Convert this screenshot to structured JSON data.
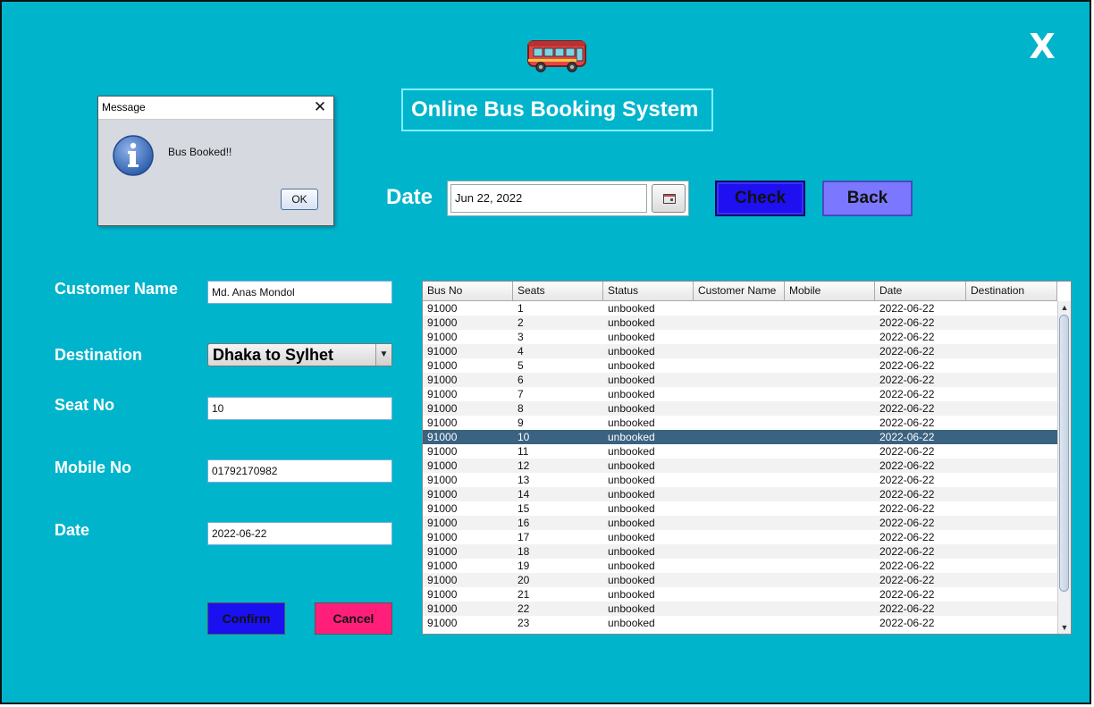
{
  "header": {
    "close_label": "X",
    "bus_logo_icon": "bus-icon",
    "title": "Online Bus Booking System"
  },
  "search": {
    "date_label": "Date",
    "date_value": "Jun 22, 2022",
    "calendar_icon": "calendar-icon",
    "check_label": "Check",
    "back_label": "Back"
  },
  "form": {
    "customer_name_label": "Customer Name",
    "customer_name_value": "Md. Anas Mondol",
    "destination_label": "Destination",
    "destination_value": "Dhaka to Sylhet",
    "seat_no_label": "Seat No",
    "seat_no_value": "10",
    "mobile_no_label": "Mobile No",
    "mobile_no_value": "01792170982",
    "date_label": "Date",
    "date_value": "2022-06-22",
    "confirm_label": "Confirm",
    "cancel_label": "Cancel"
  },
  "table": {
    "columns": [
      "Bus No",
      "Seats",
      "Status",
      "Customer Name",
      "Mobile",
      "Date",
      "Destination"
    ],
    "selected_row": 9,
    "rows": [
      [
        "91000",
        "1",
        "unbooked",
        "",
        "",
        "2022-06-22",
        ""
      ],
      [
        "91000",
        "2",
        "unbooked",
        "",
        "",
        "2022-06-22",
        ""
      ],
      [
        "91000",
        "3",
        "unbooked",
        "",
        "",
        "2022-06-22",
        ""
      ],
      [
        "91000",
        "4",
        "unbooked",
        "",
        "",
        "2022-06-22",
        ""
      ],
      [
        "91000",
        "5",
        "unbooked",
        "",
        "",
        "2022-06-22",
        ""
      ],
      [
        "91000",
        "6",
        "unbooked",
        "",
        "",
        "2022-06-22",
        ""
      ],
      [
        "91000",
        "7",
        "unbooked",
        "",
        "",
        "2022-06-22",
        ""
      ],
      [
        "91000",
        "8",
        "unbooked",
        "",
        "",
        "2022-06-22",
        ""
      ],
      [
        "91000",
        "9",
        "unbooked",
        "",
        "",
        "2022-06-22",
        ""
      ],
      [
        "91000",
        "10",
        "unbooked",
        "",
        "",
        "2022-06-22",
        ""
      ],
      [
        "91000",
        "11",
        "unbooked",
        "",
        "",
        "2022-06-22",
        ""
      ],
      [
        "91000",
        "12",
        "unbooked",
        "",
        "",
        "2022-06-22",
        ""
      ],
      [
        "91000",
        "13",
        "unbooked",
        "",
        "",
        "2022-06-22",
        ""
      ],
      [
        "91000",
        "14",
        "unbooked",
        "",
        "",
        "2022-06-22",
        ""
      ],
      [
        "91000",
        "15",
        "unbooked",
        "",
        "",
        "2022-06-22",
        ""
      ],
      [
        "91000",
        "16",
        "unbooked",
        "",
        "",
        "2022-06-22",
        ""
      ],
      [
        "91000",
        "17",
        "unbooked",
        "",
        "",
        "2022-06-22",
        ""
      ],
      [
        "91000",
        "18",
        "unbooked",
        "",
        "",
        "2022-06-22",
        ""
      ],
      [
        "91000",
        "19",
        "unbooked",
        "",
        "",
        "2022-06-22",
        ""
      ],
      [
        "91000",
        "20",
        "unbooked",
        "",
        "",
        "2022-06-22",
        ""
      ],
      [
        "91000",
        "21",
        "unbooked",
        "",
        "",
        "2022-06-22",
        ""
      ],
      [
        "91000",
        "22",
        "unbooked",
        "",
        "",
        "2022-06-22",
        ""
      ],
      [
        "91000",
        "23",
        "unbooked",
        "",
        "",
        "2022-06-22",
        ""
      ]
    ]
  },
  "dialog": {
    "title": "Message",
    "message": "Bus Booked!!",
    "ok_label": "OK",
    "icon": "info-icon"
  },
  "colors": {
    "background": "#00b4cc",
    "check_button": "#1e10f0",
    "back_button": "#7b78ff",
    "confirm_button": "#1a10f0",
    "cancel_button": "#ff1f7a",
    "selected_row": "#3a6281"
  }
}
